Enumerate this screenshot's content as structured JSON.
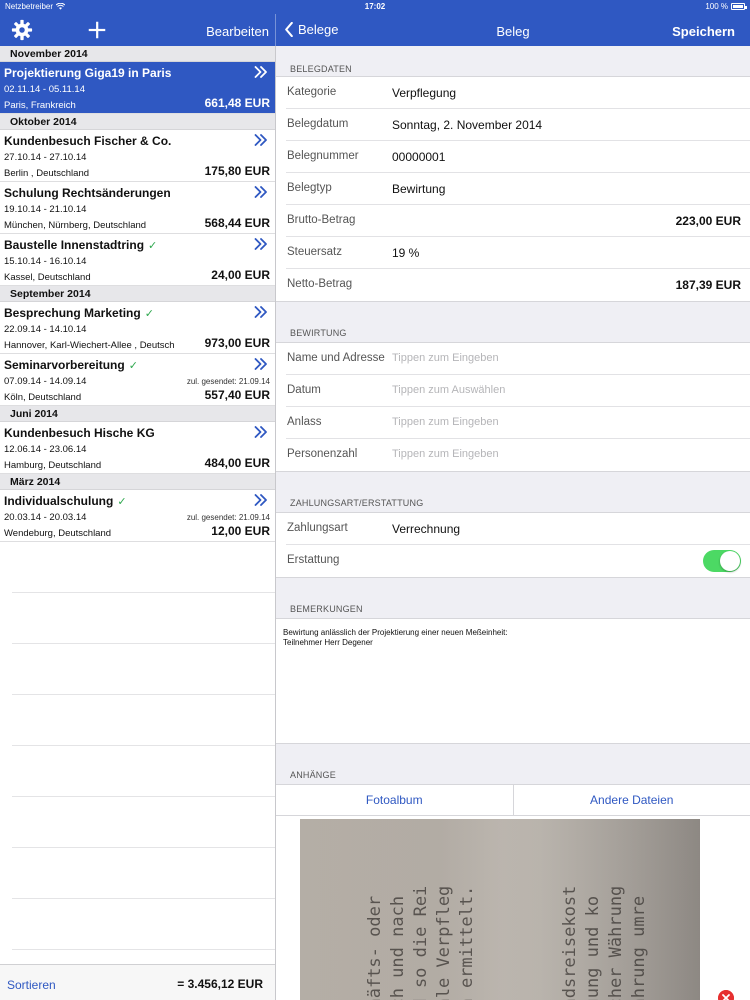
{
  "status": {
    "carrier": "Netzbetreiber",
    "time": "17:02",
    "battery": "100 %"
  },
  "header": {
    "edit_label": "Bearbeiten",
    "back_label": "Belege",
    "title": "Beleg",
    "save_label": "Speichern"
  },
  "trips": [
    {
      "month": "November 2014"
    },
    {
      "title": "Projektierung Giga19 in Paris",
      "dates": "02.11.14 - 05.11.14",
      "location": "Paris, Frankreich",
      "amount": "661,48 EUR",
      "selected": true
    },
    {
      "month": "Oktober 2014"
    },
    {
      "title": "Kundenbesuch Fischer & Co.",
      "dates": "27.10.14 - 27.10.14",
      "location": "Berlin , Deutschland",
      "amount": "175,80 EUR"
    },
    {
      "title": "Schulung Rechtsänderungen",
      "dates": "19.10.14 - 21.10.14",
      "location": "München, Nürnberg, Deutschland",
      "amount": "568,44 EUR"
    },
    {
      "title": "Baustelle Innenstadtring",
      "dates": "15.10.14 - 16.10.14",
      "location": "Kassel, Deutschland",
      "amount": "24,00 EUR",
      "check": true
    },
    {
      "month": "September 2014"
    },
    {
      "title": "Besprechung Marketing",
      "dates": "22.09.14 - 14.10.14",
      "location": "Hannover, Karl-Wiechert-Allee , Deutsch",
      "amount": "973,00 EUR",
      "check": true
    },
    {
      "title": "Seminarvorbereitung",
      "dates": "07.09.14 - 14.09.14",
      "location": "Köln, Deutschland",
      "amount": "557,40 EUR",
      "check": true,
      "sent": "zul. gesendet: 21.09.14"
    },
    {
      "month": "Juni 2014"
    },
    {
      "title": "Kundenbesuch Hische KG",
      "dates": "12.06.14 - 23.06.14",
      "location": "Hamburg, Deutschland",
      "amount": "484,00 EUR"
    },
    {
      "month": "März 2014"
    },
    {
      "title": "Individualschulung",
      "dates": "20.03.14 - 20.03.14",
      "location": "Wendeburg, Deutschland",
      "amount": "12,00 EUR",
      "check": true,
      "sent": "zul. gesendet: 21.09.14"
    }
  ],
  "footer": {
    "sort_label": "Sortieren",
    "total": "= 3.456,12 EUR"
  },
  "form": {
    "belegdaten_header": "BELEGDATEN",
    "belegdaten": [
      {
        "label": "Kategorie",
        "value": "Verpflegung"
      },
      {
        "label": "Belegdatum",
        "value": "Sonntag, 2. November 2014"
      },
      {
        "label": "Belegnummer",
        "value": "00000001"
      },
      {
        "label": "Belegtyp",
        "value": "Bewirtung"
      },
      {
        "label": "Brutto-Betrag",
        "amount": "223,00 EUR"
      },
      {
        "label": "Steuersatz",
        "value": "19 %"
      },
      {
        "label": "Netto-Betrag",
        "amount": "187,39 EUR"
      }
    ],
    "bewirtung_header": "BEWIRTUNG",
    "bewirtung": [
      {
        "label": "Name und Adresse",
        "placeholder": "Tippen zum Eingeben"
      },
      {
        "label": "Datum",
        "placeholder": "Tippen zum Auswählen"
      },
      {
        "label": "Anlass",
        "placeholder": "Tippen zum Eingeben"
      },
      {
        "label": "Personenzahl",
        "placeholder": "Tippen zum Eingeben"
      }
    ],
    "zahlung_header": "ZAHLUNGSART/ERSTATTUNG",
    "zahlungsart_label": "Zahlungsart",
    "zahlungsart_value": "Verrechnung",
    "erstattung_label": "Erstattung",
    "erstattung_on": true,
    "bemerkungen_header": "BEMERKUNGEN",
    "bemerkungen": "Bewirtung anlässlich der Projektierung einer neuen Meßeinheit:\nTeilnehmer Herr Degener",
    "anhaenge_header": "ANHÄNGE",
    "fotoalbum_label": "Fotoalbum",
    "andere_label": "Andere Dateien"
  },
  "colors": {
    "accent": "#2f58c2",
    "toggle_on": "#4cd964",
    "check": "#2fa84f",
    "delete": "#e63030"
  }
}
